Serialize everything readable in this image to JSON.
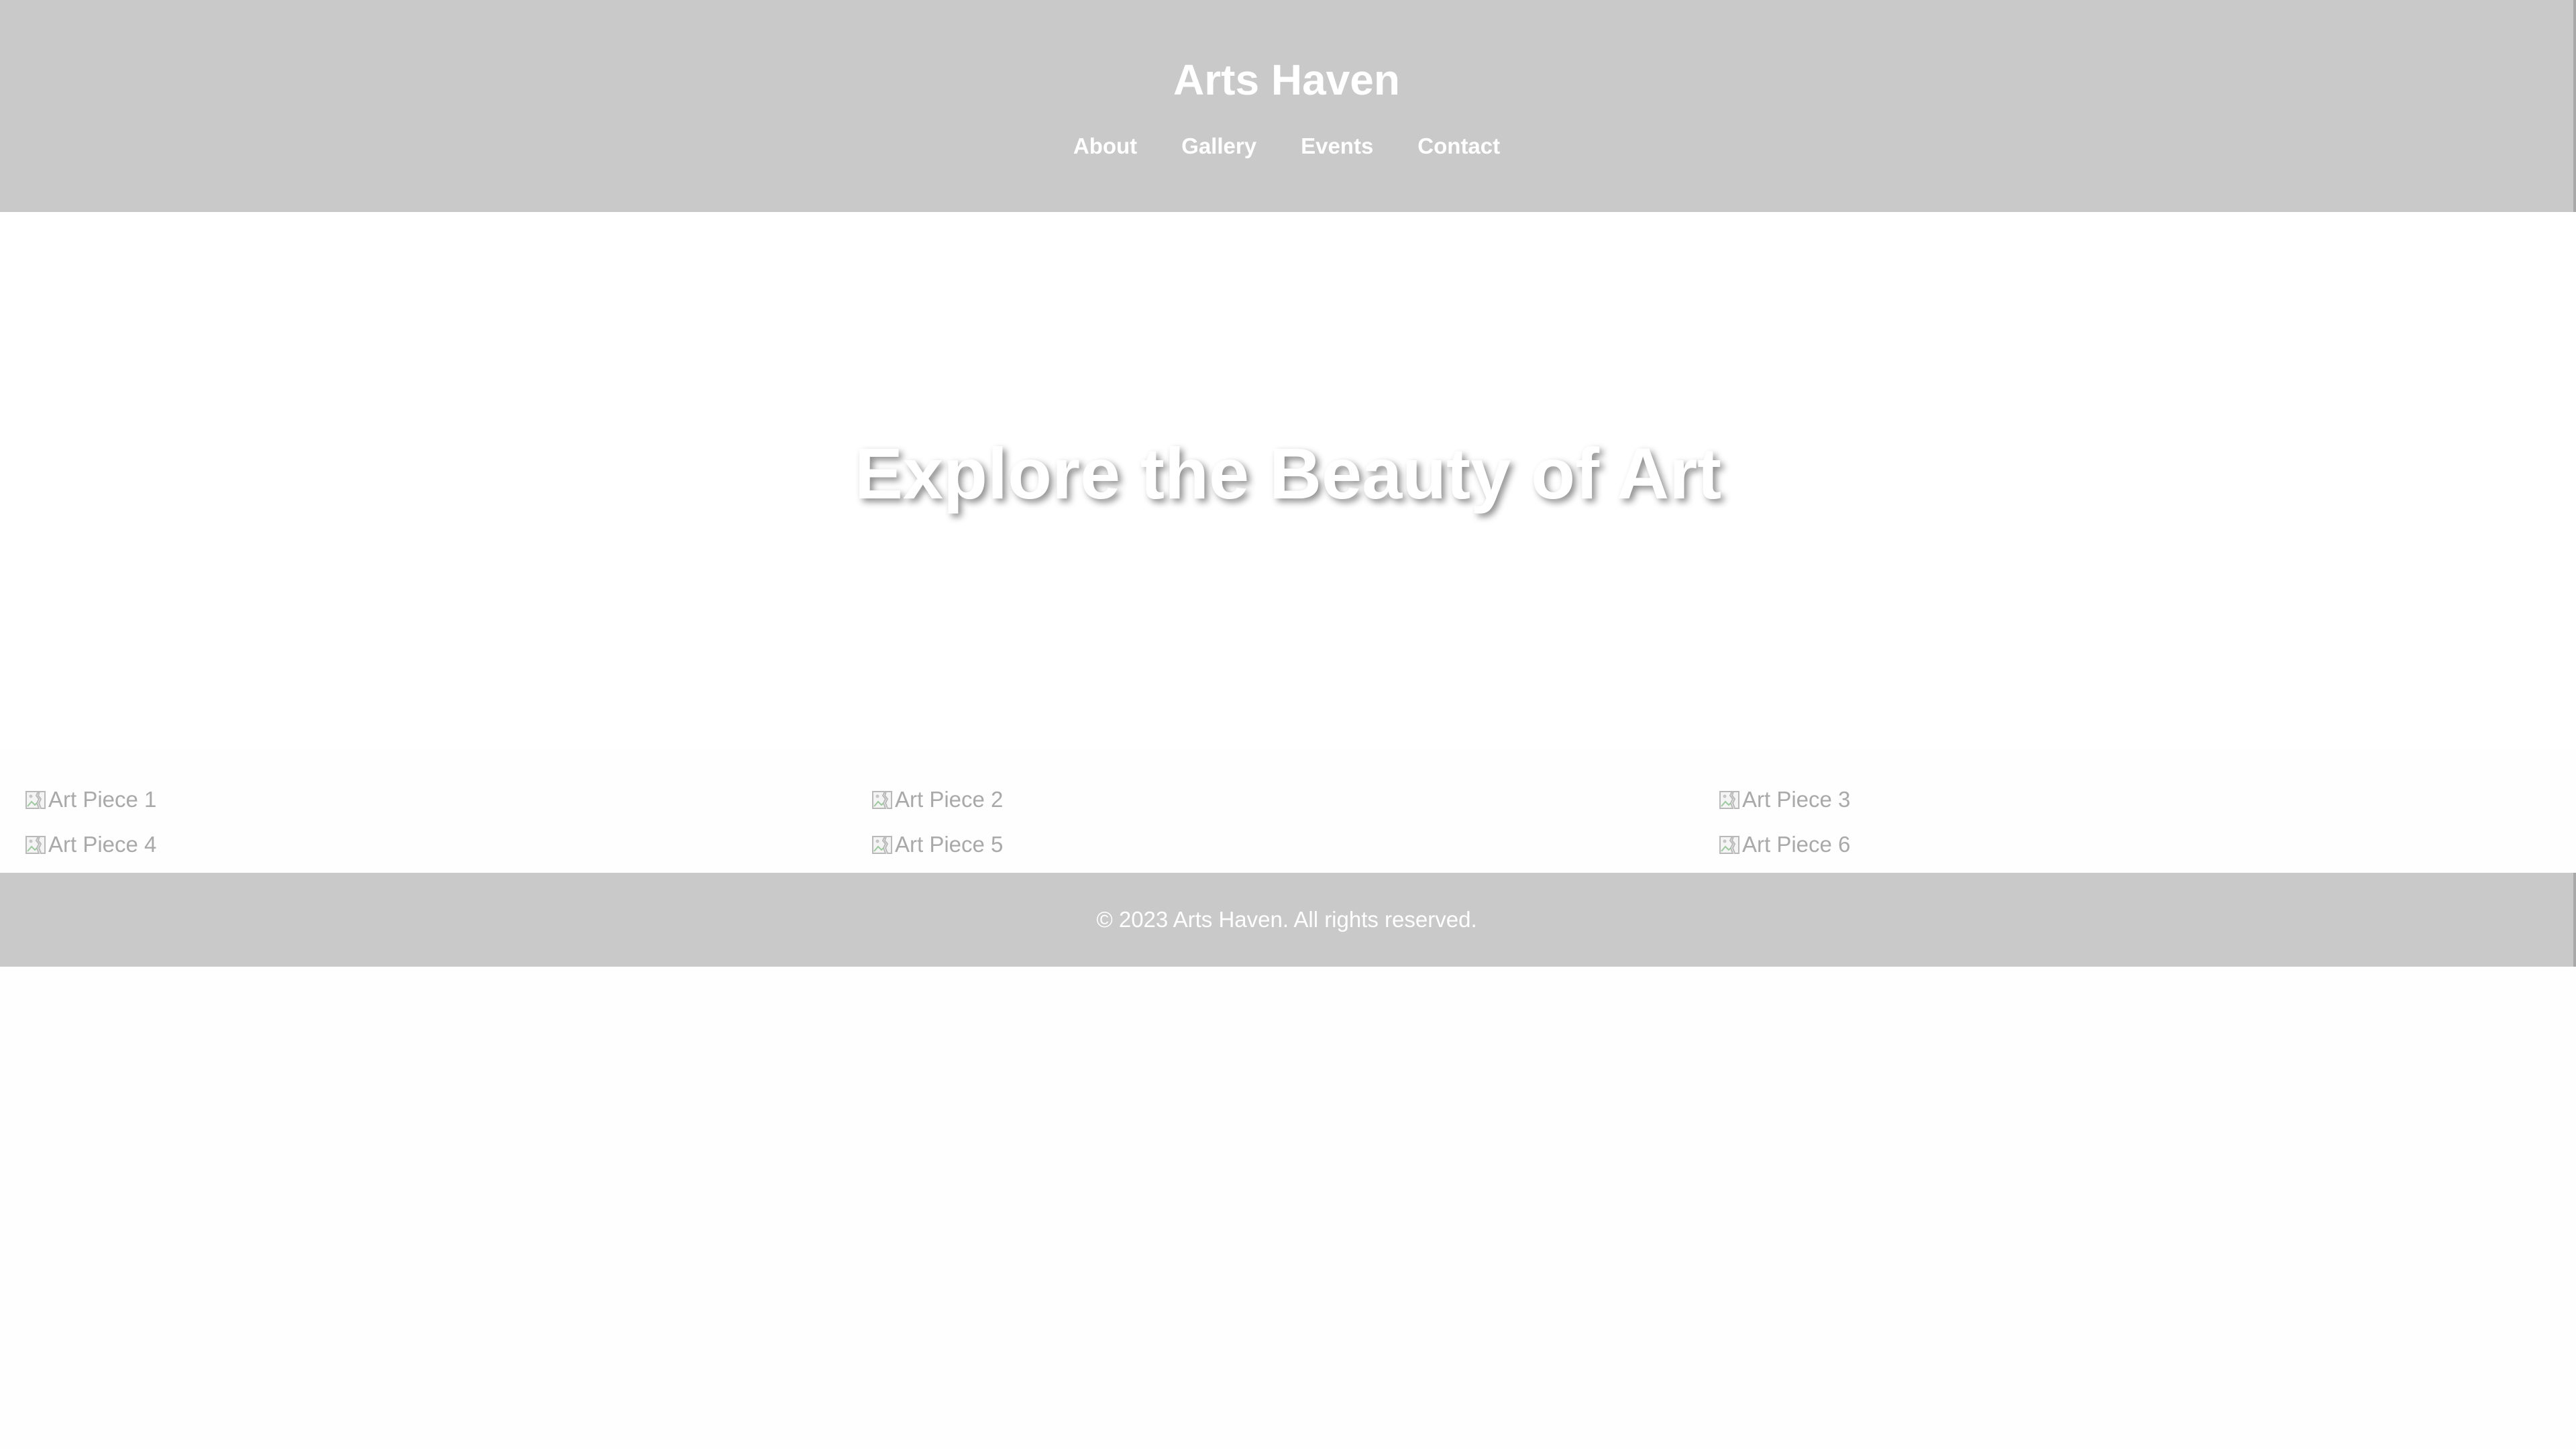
{
  "header": {
    "title": "Arts Haven",
    "nav": [
      "About",
      "Gallery",
      "Events",
      "Contact"
    ]
  },
  "hero": {
    "title": "Explore the Beauty of Art"
  },
  "gallery": {
    "items": [
      {
        "alt": "Art Piece 1",
        "icon": "broken-image-icon"
      },
      {
        "alt": "Art Piece 2",
        "icon": "broken-image-icon"
      },
      {
        "alt": "Art Piece 3",
        "icon": "broken-image-icon"
      },
      {
        "alt": "Art Piece 4",
        "icon": "broken-image-icon"
      },
      {
        "alt": "Art Piece 5",
        "icon": "broken-image-icon"
      },
      {
        "alt": "Art Piece 6",
        "icon": "broken-image-icon"
      }
    ]
  },
  "footer": {
    "text": "© 2023 Arts Haven. All rights reserved."
  },
  "colors": {
    "header_bg": "#c9c9c9",
    "footer_bg": "#c9c9c9",
    "text_light": "#ffffff",
    "alt_text": "#a9a9a9"
  }
}
